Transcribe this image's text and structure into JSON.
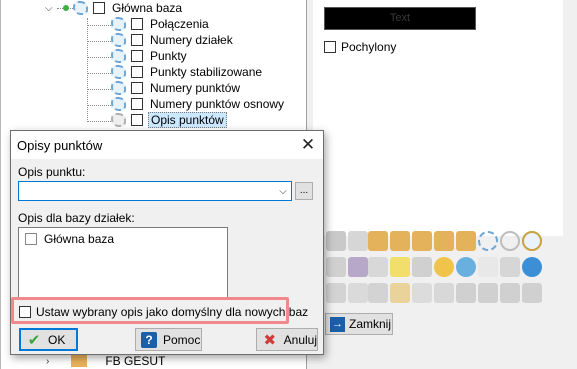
{
  "tree": {
    "root_label": "Główna baza",
    "children": [
      "Połączenia",
      "Numery działek",
      "Punkty",
      "Punkty stabilizowane",
      "Numery punktów",
      "Numery punktów osnowy",
      "Opis punktów"
    ],
    "selected_index": 6,
    "peek_label": "FB GESUT"
  },
  "right_panel": {
    "color_swatch_text": "Text",
    "tilt_label": "Pochylony",
    "tilt_checked": false,
    "close_button_label": "Zamknij"
  },
  "dialog": {
    "title": "Opisy punktów",
    "point_desc_label": "Opis punktu:",
    "point_desc_value": "",
    "browse_label": "...",
    "db_desc_label": "Opis dla bazy działek:",
    "db_list": [
      {
        "label": "Główna baza",
        "checked": false
      }
    ],
    "default_checkbox_label": "Ustaw wybrany opis jako domyślny dla nowych baz",
    "default_checked": false,
    "buttons": {
      "ok": "OK",
      "help": "Pomoc",
      "cancel": "Anuluj"
    }
  },
  "colors": {
    "accent": "#0078d7",
    "highlight_box": "#f08a8a",
    "selection": "#cce8ff"
  },
  "icons": {
    "ok": "checkmark-icon",
    "help": "question-icon",
    "cancel": "x-icon",
    "close_window": "close-icon",
    "combo": "chevron-down-icon",
    "zamknij": "exit-icon"
  }
}
